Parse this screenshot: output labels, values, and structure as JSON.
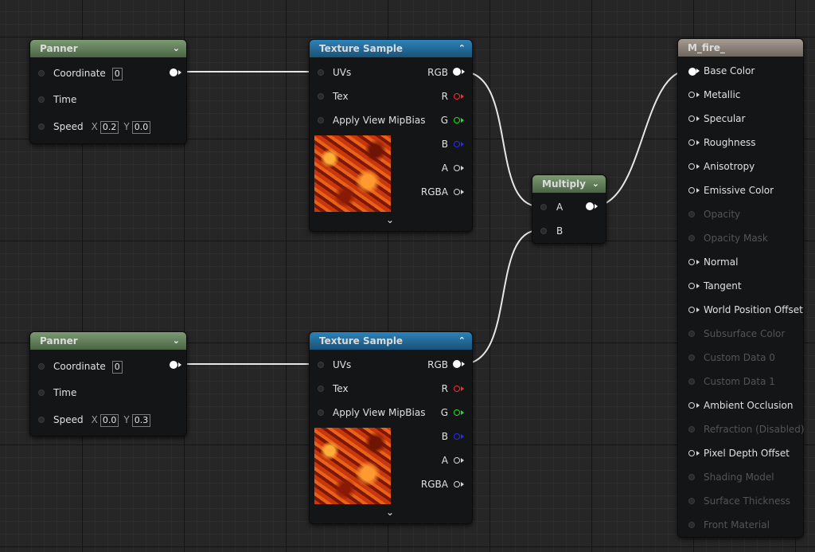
{
  "panner1": {
    "title": "Panner",
    "coordinate_label": "Coordinate",
    "coordinate_value": "0",
    "time_label": "Time",
    "speed_label": "Speed",
    "speed_x_label": "X",
    "speed_x": "0.2",
    "speed_y_label": "Y",
    "speed_y": "0.0"
  },
  "panner2": {
    "title": "Panner",
    "coordinate_label": "Coordinate",
    "coordinate_value": "0",
    "time_label": "Time",
    "speed_label": "Speed",
    "speed_x_label": "X",
    "speed_x": "0.0",
    "speed_y_label": "Y",
    "speed_y": "0.3"
  },
  "texture1": {
    "title": "Texture Sample",
    "inputs": [
      "UVs",
      "Tex",
      "Apply View MipBias"
    ],
    "outputs": [
      "RGB",
      "R",
      "G",
      "B",
      "A",
      "RGBA"
    ]
  },
  "texture2": {
    "title": "Texture Sample",
    "inputs": [
      "UVs",
      "Tex",
      "Apply View MipBias"
    ],
    "outputs": [
      "RGB",
      "R",
      "G",
      "B",
      "A",
      "RGBA"
    ]
  },
  "multiply": {
    "title": "Multiply",
    "inputs": [
      "A",
      "B"
    ]
  },
  "material": {
    "title": "M_fire_",
    "inputs": [
      {
        "label": "Base Color",
        "enabled": true,
        "connected": true
      },
      {
        "label": "Metallic",
        "enabled": true,
        "connected": false
      },
      {
        "label": "Specular",
        "enabled": true,
        "connected": false
      },
      {
        "label": "Roughness",
        "enabled": true,
        "connected": false
      },
      {
        "label": "Anisotropy",
        "enabled": true,
        "connected": false
      },
      {
        "label": "Emissive Color",
        "enabled": true,
        "connected": false
      },
      {
        "label": "Opacity",
        "enabled": false,
        "connected": false
      },
      {
        "label": "Opacity Mask",
        "enabled": false,
        "connected": false
      },
      {
        "label": "Normal",
        "enabled": true,
        "connected": false
      },
      {
        "label": "Tangent",
        "enabled": true,
        "connected": false
      },
      {
        "label": "World Position Offset",
        "enabled": true,
        "connected": false
      },
      {
        "label": "Subsurface Color",
        "enabled": false,
        "connected": false
      },
      {
        "label": "Custom Data 0",
        "enabled": false,
        "connected": false
      },
      {
        "label": "Custom Data 1",
        "enabled": false,
        "connected": false
      },
      {
        "label": "Ambient Occlusion",
        "enabled": true,
        "connected": false
      },
      {
        "label": "Refraction (Disabled)",
        "enabled": false,
        "connected": false
      },
      {
        "label": "Pixel Depth Offset",
        "enabled": true,
        "connected": false
      },
      {
        "label": "Shading Model",
        "enabled": false,
        "connected": false
      },
      {
        "label": "Surface Thickness",
        "enabled": false,
        "connected": false
      },
      {
        "label": "Front Material",
        "enabled": false,
        "connected": false
      }
    ]
  },
  "colors": {
    "pin_r": "#ff2a2a",
    "pin_g": "#22e022",
    "pin_b": "#2a2aff",
    "wire": "#e6e6e6"
  }
}
